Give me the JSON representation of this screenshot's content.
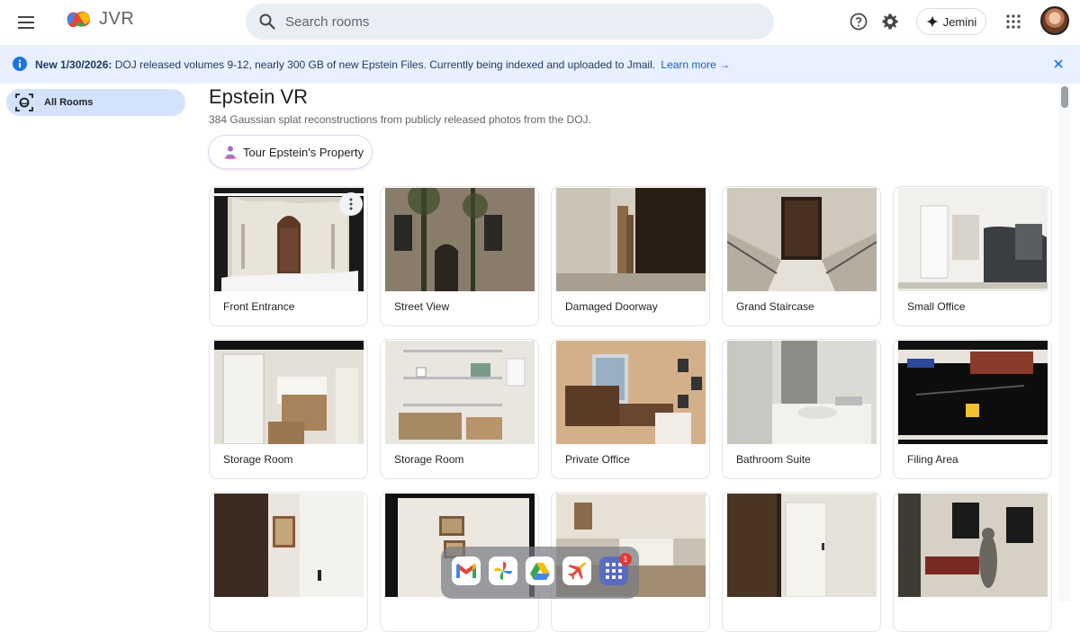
{
  "app": {
    "name": "JVR"
  },
  "search": {
    "placeholder": "Search rooms"
  },
  "header": {
    "jemini_label": "Jemini"
  },
  "banner": {
    "prefix": "New 1/30/2026:",
    "message": "DOJ released volumes 9-12, nearly 300 GB of new Epstein Files. Currently being indexed and uploaded to Jmail.",
    "link": "Learn more →"
  },
  "sidebar": {
    "items": [
      {
        "label": "All Rooms",
        "icon": "all-rooms-icon",
        "active": true
      }
    ]
  },
  "main": {
    "title": "Epstein VR",
    "subtitle": "384 Gaussian splat reconstructions from publicly released photos from the DOJ.",
    "tour_button": "Tour Epstein's Property"
  },
  "rooms": [
    {
      "label": "Front Entrance",
      "scene": "entrance"
    },
    {
      "label": "Street View",
      "scene": "street"
    },
    {
      "label": "Damaged Doorway",
      "scene": "damaged"
    },
    {
      "label": "Grand Staircase",
      "scene": "staircase"
    },
    {
      "label": "Small Office",
      "scene": "smalloffice"
    },
    {
      "label": "Storage Room",
      "scene": "storage1"
    },
    {
      "label": "Storage Room",
      "scene": "storage2"
    },
    {
      "label": "Private Office",
      "scene": "privateoffice"
    },
    {
      "label": "Bathroom Suite",
      "scene": "bathroom"
    },
    {
      "label": "Filing Area",
      "scene": "filing"
    },
    {
      "label": "",
      "scene": "hall1"
    },
    {
      "label": "",
      "scene": "hall2"
    },
    {
      "label": "",
      "scene": "parlor"
    },
    {
      "label": "",
      "scene": "corridor"
    },
    {
      "label": "",
      "scene": "gallery"
    }
  ],
  "dock": {
    "apps": [
      "mail-icon",
      "photos-icon",
      "drive-icon",
      "flights-icon",
      "app-grid-icon"
    ],
    "badge": "1"
  },
  "colors": {
    "accent": "#1a73e8",
    "banner_bg": "#e8f0fe",
    "sidebar_active": "#d3e3fd"
  }
}
